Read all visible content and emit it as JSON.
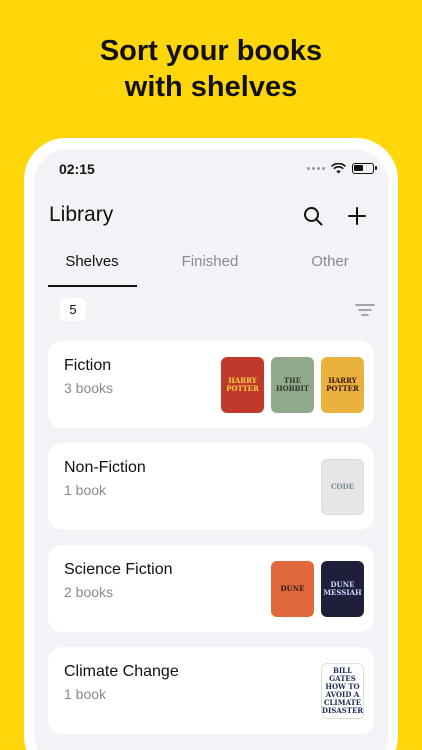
{
  "headline": {
    "line1": "Sort your books",
    "line2": "with shelves"
  },
  "status": {
    "time": "02:15"
  },
  "nav": {
    "title": "Library",
    "search_icon": "search-icon",
    "add_icon": "plus-icon"
  },
  "tabs": [
    {
      "label": "Shelves",
      "active": true
    },
    {
      "label": "Finished",
      "active": false
    },
    {
      "label": "Other",
      "active": false
    }
  ],
  "shelf_count": "5",
  "shelves": [
    {
      "name": "Fiction",
      "count": "3 books",
      "covers": [
        {
          "text": "HARRY POTTER",
          "bg": "#c0392b",
          "fg": "#f5d142"
        },
        {
          "text": "THE HOBBIT",
          "bg": "#8fa98a",
          "fg": "#2e3b2a"
        },
        {
          "text": "HARRY POTTER",
          "bg": "#e9b23f",
          "fg": "#3b1a0e"
        }
      ]
    },
    {
      "name": "Non-Fiction",
      "count": "1 book",
      "covers": [
        {
          "text": "CODE",
          "bg": "#e6e6e6",
          "fg": "#6f8a8f"
        }
      ]
    },
    {
      "name": "Science Fiction",
      "count": "2 books",
      "covers": [
        {
          "text": "DUNE",
          "bg": "#e0683a",
          "fg": "#2b1b1b"
        },
        {
          "text": "DUNE MESSIAH",
          "bg": "#1f1f3a",
          "fg": "#c9d6ff"
        }
      ]
    },
    {
      "name": "Climate Change",
      "count": "1 book",
      "covers": [
        {
          "text": "BILL GATES HOW TO AVOID A CLIMATE DISASTER",
          "bg": "#ffffff",
          "fg": "#1c2a5a"
        }
      ]
    }
  ]
}
